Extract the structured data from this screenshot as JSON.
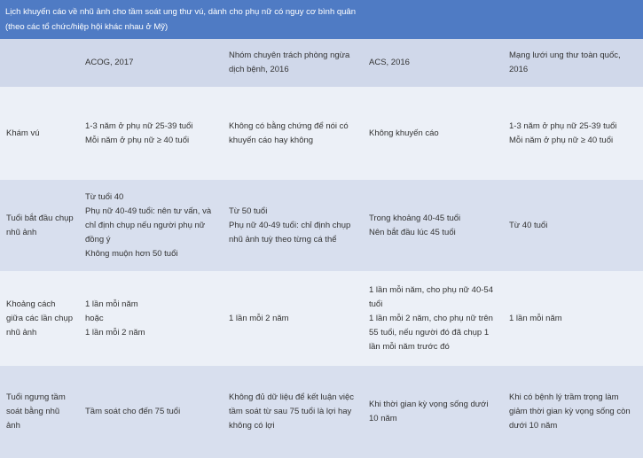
{
  "title": {
    "line1": "Lịch khuyến cáo về nhũ ảnh cho tầm soát ung thư vú, dành cho phụ nữ có nguy cơ bình quân",
    "line2": "(theo các tổ chức/hiệp hội khác nhau ở Mỹ)"
  },
  "headers": [
    "",
    "ACOG, 2017",
    "Nhóm chuyên trách phòng ngừa dịch bệnh,  2016",
    "ACS, 2016",
    "Mạng lưới ung thư toàn quốc, 2016"
  ],
  "rows": [
    {
      "label": "Khám vú",
      "cells": [
        [
          "1-3 năm ở phụ nữ 25-39 tuổi",
          "Mỗi năm ở phụ nữ ≥ 40 tuổi"
        ],
        [
          "Không có bằng chứng để nói có khuyến cáo hay không"
        ],
        [
          "Không khuyến cáo"
        ],
        [
          "1-3 năm ở phụ nữ 25-39 tuổi",
          "Mỗi năm ở phụ nữ ≥ 40 tuổi"
        ]
      ]
    },
    {
      "label": "Tuổi bắt đầu chụp nhũ ảnh",
      "cells": [
        [
          "Từ tuổi 40",
          "Phụ nữ 40-49 tuổi: nên tư vấn, và chỉ định chụp nếu người phụ nữ đồng ý",
          "Không muộn hơn 50 tuổi"
        ],
        [
          "Từ 50 tuổi",
          "Phụ nữ 40-49 tuổi: chỉ định chụp nhũ ảnh tuỳ theo từng cá thể"
        ],
        [
          "Trong khoảng 40-45 tuổi",
          "Nên bắt đầu lúc 45 tuổi"
        ],
        [
          "Từ 40 tuổi"
        ]
      ]
    },
    {
      "label": "Khoảng cách giữa các lần chụp nhũ ảnh",
      "cells": [
        [
          "1 lần mỗi năm",
          "hoặc",
          "1 lần mỗi 2 năm"
        ],
        [
          "1 lần mỗi 2 năm"
        ],
        [
          "1 lần mỗi năm, cho phụ nữ 40-54 tuổi",
          "1 lần mỗi 2 năm, cho phụ nữ trên 55 tuổi, nếu người đó đã chụp 1 lần mỗi năm trước đó"
        ],
        [
          "1 lần mỗi năm"
        ]
      ]
    },
    {
      "label": "Tuổi ngưng tầm soát bằng nhũ ảnh",
      "cells": [
        [
          "Tầm soát cho đến 75 tuổi"
        ],
        [
          "Không đủ dữ liệu để kết luận việc tầm soát từ sau 75 tuổi là lợi hay không có lợi"
        ],
        [
          "Khi thời gian kỳ vọng sống dưới 10 năm"
        ],
        [
          "Khi có bệnh lý trầm trọng làm giảm thời gian kỳ vọng sống còn dưới 10 năm"
        ]
      ]
    }
  ],
  "colors": {
    "title_bg": "#4f7bc4",
    "row_dark": "#d8dfee",
    "row_light": "#ecf0f7"
  }
}
